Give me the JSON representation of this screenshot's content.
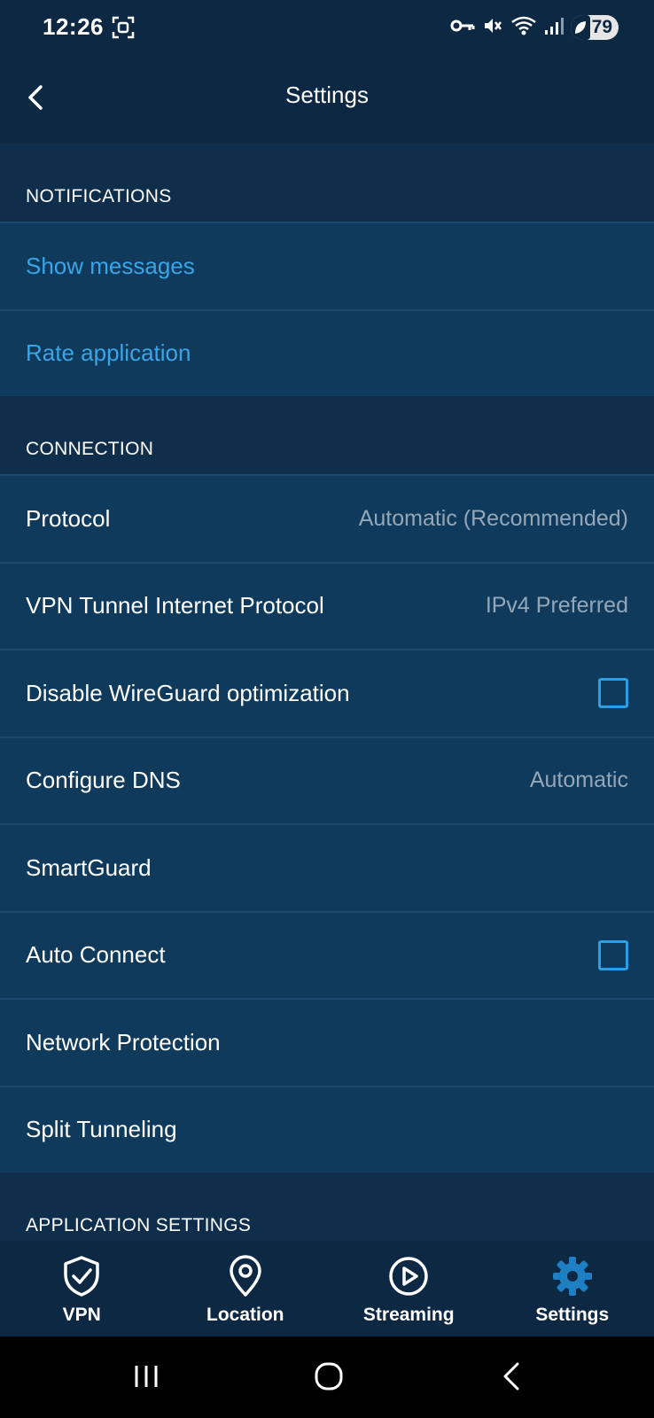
{
  "status_bar": {
    "time": "12:26",
    "battery": "79"
  },
  "header": {
    "title": "Settings"
  },
  "sections": {
    "notifications": {
      "title": "NOTIFICATIONS",
      "items": {
        "show_messages": "Show messages",
        "rate_application": "Rate application"
      }
    },
    "connection": {
      "title": "CONNECTION",
      "protocol": {
        "label": "Protocol",
        "value": "Automatic (Recommended)"
      },
      "tunnel_protocol": {
        "label": "VPN Tunnel Internet Protocol",
        "value": "IPv4 Preferred"
      },
      "wireguard": {
        "label": "Disable WireGuard optimization",
        "checked": false
      },
      "dns": {
        "label": "Configure DNS",
        "value": "Automatic"
      },
      "smartguard": {
        "label": "SmartGuard"
      },
      "auto_connect": {
        "label": "Auto Connect",
        "checked": false
      },
      "network_protection": {
        "label": "Network Protection"
      },
      "split_tunneling": {
        "label": "Split Tunneling"
      }
    },
    "application_settings": {
      "title": "APPLICATION SETTINGS"
    }
  },
  "bottom_nav": {
    "vpn": "VPN",
    "location": "Location",
    "streaming": "Streaming",
    "settings": "Settings",
    "active_color": "#1e7fc4"
  }
}
